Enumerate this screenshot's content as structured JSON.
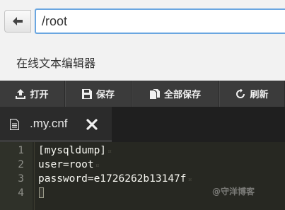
{
  "path_bar": {
    "back_icon": "arrow-left-icon",
    "path_value": "/root"
  },
  "title": "在线文本编辑器",
  "toolbar": {
    "open_label": "打开",
    "open_icon": "upload-icon",
    "save_label": "保存",
    "save_icon": "floppy-disk-icon",
    "save_all_label": "全部保存",
    "save_all_icon": "copy-files-icon",
    "refresh_label": "刷新",
    "refresh_icon": "refresh-icon"
  },
  "tab": {
    "label": ".my.cnf",
    "file_icon": "file-text-icon",
    "close_icon": "close-icon"
  },
  "editor": {
    "lines": [
      {
        "num": "1",
        "text": "[mysqldump]"
      },
      {
        "num": "2",
        "text": "user=root"
      },
      {
        "num": "3",
        "text": "password=e1726262b13147f"
      },
      {
        "num": "4",
        "text": ""
      }
    ],
    "eol_marker": "¤"
  },
  "watermark": "@守洋博客",
  "colors": {
    "toolbar_bg": "#3b3b3b",
    "editor_bg": "#272822",
    "input_border": "#6aa6e0"
  }
}
